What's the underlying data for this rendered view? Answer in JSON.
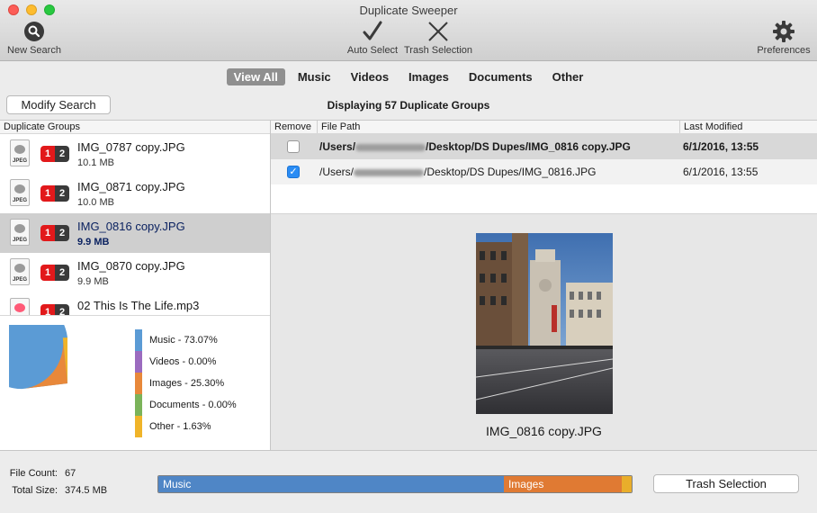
{
  "window": {
    "title": "Duplicate Sweeper"
  },
  "toolbar": {
    "new_search": {
      "label": "New Search",
      "icon": "search-icon"
    },
    "auto_select": {
      "label": "Auto Select",
      "icon": "checkmark-icon"
    },
    "trash_selection": {
      "label": "Trash Selection",
      "icon": "x-icon"
    },
    "preferences": {
      "label": "Preferences",
      "icon": "gear-icon"
    }
  },
  "tabs": [
    {
      "label": "View All",
      "active": true
    },
    {
      "label": "Music",
      "active": false
    },
    {
      "label": "Videos",
      "active": false
    },
    {
      "label": "Images",
      "active": false
    },
    {
      "label": "Documents",
      "active": false
    },
    {
      "label": "Other",
      "active": false
    }
  ],
  "modify_search_label": "Modify Search",
  "displaying_text": "Displaying 57 Duplicate Groups",
  "groups_header": "Duplicate Groups",
  "groups": [
    {
      "name": "IMG_0787 copy.JPG",
      "size": "10.1 MB",
      "count_a": "1",
      "count_b": "2",
      "kind": "JPEG",
      "selected": false
    },
    {
      "name": "IMG_0871 copy.JPG",
      "size": "10.0 MB",
      "count_a": "1",
      "count_b": "2",
      "kind": "JPEG",
      "selected": false
    },
    {
      "name": "IMG_0816 copy.JPG",
      "size": "9.9 MB",
      "count_a": "1",
      "count_b": "2",
      "kind": "JPEG",
      "selected": true
    },
    {
      "name": "IMG_0870 copy.JPG",
      "size": "9.9 MB",
      "count_a": "1",
      "count_b": "2",
      "kind": "JPEG",
      "selected": false
    },
    {
      "name": "02 This Is The Life.mp3",
      "size": "",
      "count_a": "1",
      "count_b": "2",
      "kind": "",
      "selected": false
    }
  ],
  "pie": {
    "legend": [
      {
        "label": "Music - 73.07%",
        "color": "#5b9bd5"
      },
      {
        "label": "Videos - 0.00%",
        "color": "#9b6bbf"
      },
      {
        "label": "Images - 25.30%",
        "color": "#e8883a"
      },
      {
        "label": "Documents - 0.00%",
        "color": "#7bb35a"
      },
      {
        "label": "Other - 1.63%",
        "color": "#f0b429"
      }
    ],
    "slices": [
      {
        "name": "Music",
        "percent": 73.07,
        "color": "#5b9bd5"
      },
      {
        "name": "Videos",
        "percent": 0.0,
        "color": "#9b6bbf"
      },
      {
        "name": "Images",
        "percent": 25.3,
        "color": "#e8883a"
      },
      {
        "name": "Documents",
        "percent": 0.0,
        "color": "#7bb35a"
      },
      {
        "name": "Other",
        "percent": 1.63,
        "color": "#f0b429"
      }
    ]
  },
  "file_table": {
    "headers": {
      "remove": "Remove",
      "path": "File Path",
      "modified": "Last Modified"
    },
    "rows": [
      {
        "checked": false,
        "path_prefix": "/Users/",
        "path_suffix": "/Desktop/DS Dupes/IMG_0816 copy.JPG",
        "modified": "6/1/2016, 13:55"
      },
      {
        "checked": true,
        "path_prefix": "/Users/",
        "path_suffix": "/Desktop/DS Dupes/IMG_0816.JPG",
        "modified": "6/1/2016, 13:55"
      }
    ]
  },
  "preview": {
    "filename": "IMG_0816 copy.JPG"
  },
  "footer": {
    "file_count_label": "File Count:",
    "file_count": "67",
    "total_size_label": "Total Size:",
    "total_size": "374.5 MB",
    "bar": [
      {
        "label": "Music",
        "fraction": 0.73,
        "color": "#4f86c6"
      },
      {
        "label": "Images",
        "fraction": 0.25,
        "color": "#e07a33"
      },
      {
        "label": "",
        "fraction": 0.02,
        "color": "#e9ae2b"
      }
    ],
    "trash_button": "Trash Selection"
  }
}
